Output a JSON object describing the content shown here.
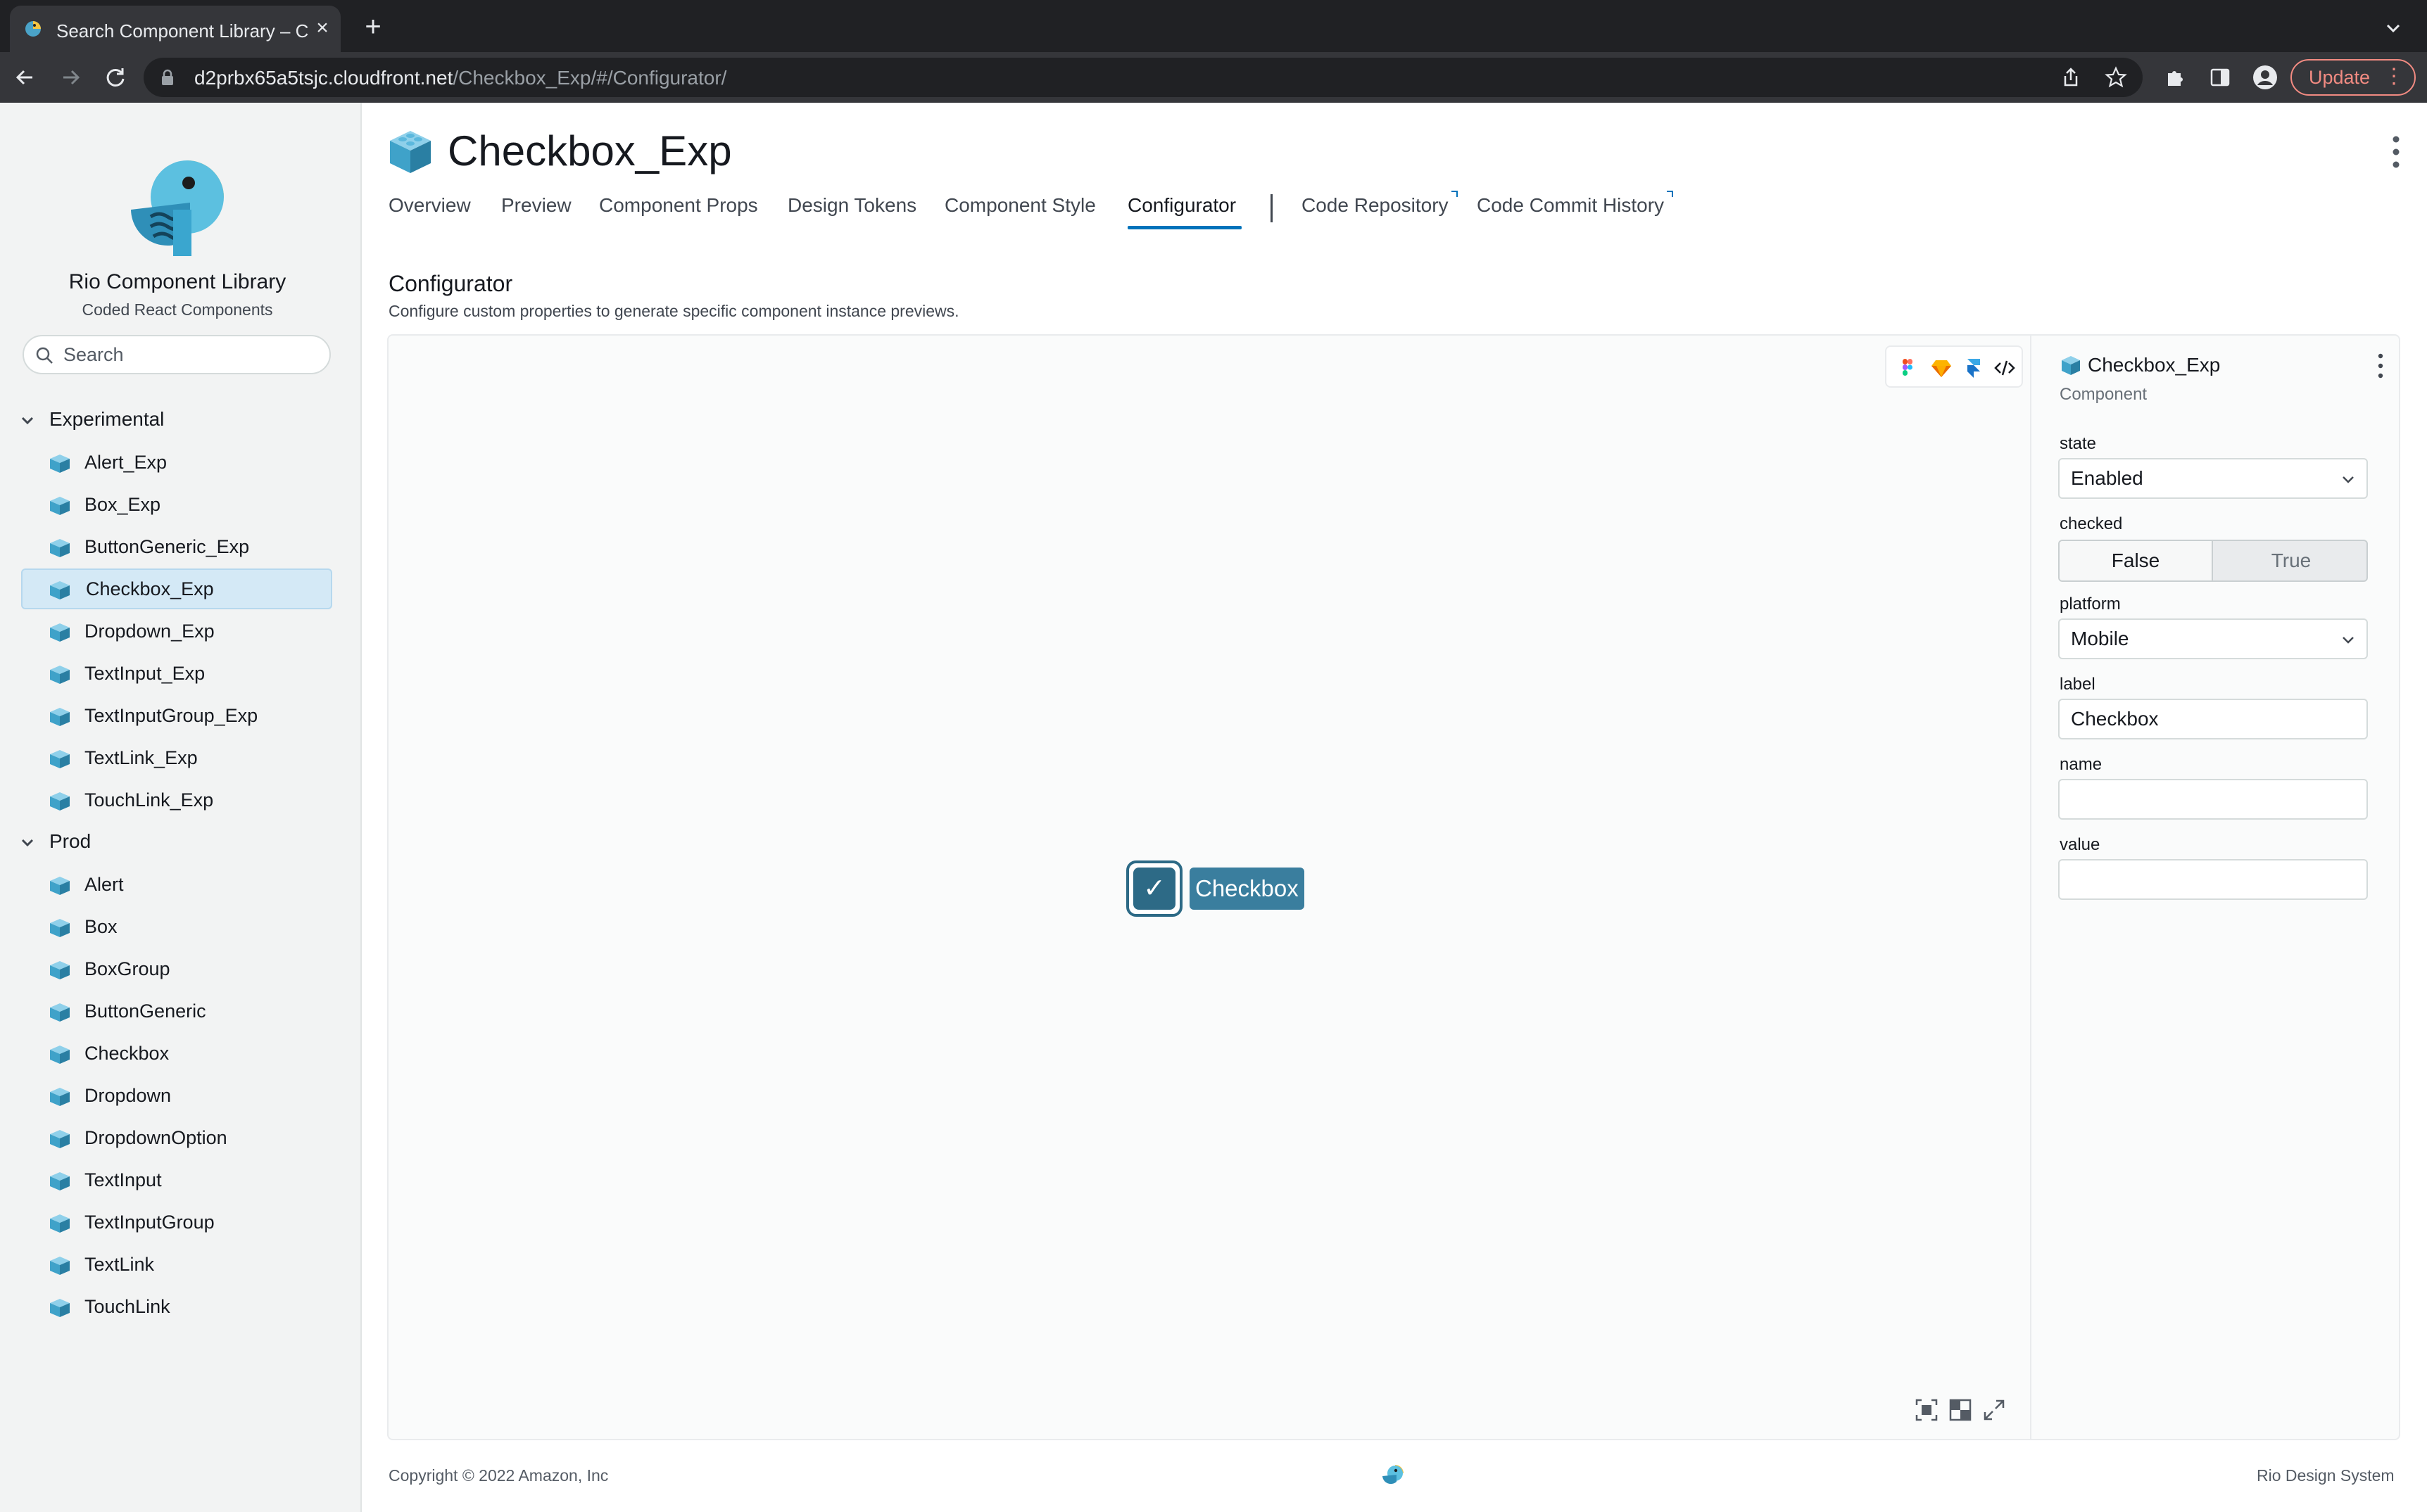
{
  "browser": {
    "tab_title": "Search Component Library – C",
    "url_host": "d2prbx65a5tsjc.cloudfront.net",
    "url_path": "/Checkbox_Exp/#/Configurator/",
    "update_label": "Update"
  },
  "sidebar": {
    "title": "Rio Component Library",
    "subtitle": "Coded React Components",
    "search_placeholder": "Search",
    "groups": [
      {
        "label": "Experimental",
        "items": [
          "Alert_Exp",
          "Box_Exp",
          "ButtonGeneric_Exp",
          "Checkbox_Exp",
          "Dropdown_Exp",
          "TextInput_Exp",
          "TextInputGroup_Exp",
          "TextLink_Exp",
          "TouchLink_Exp"
        ]
      },
      {
        "label": "Prod",
        "items": [
          "Alert",
          "Box",
          "BoxGroup",
          "ButtonGeneric",
          "Checkbox",
          "Dropdown",
          "DropdownOption",
          "TextInput",
          "TextInputGroup",
          "TextLink",
          "TouchLink"
        ]
      }
    ],
    "active_item": "Checkbox_Exp"
  },
  "header": {
    "title": "Checkbox_Exp",
    "tabs": [
      "Overview",
      "Preview",
      "Component Props",
      "Design Tokens",
      "Component Style",
      "Configurator",
      "Code Repository",
      "Code Commit History"
    ],
    "active_tab": "Configurator"
  },
  "section": {
    "title": "Configurator",
    "description": "Configure custom properties to generate specific component instance previews."
  },
  "preview": {
    "checkbox_label": "Checkbox",
    "checkbox_checked": true
  },
  "props": {
    "title": "Checkbox_Exp",
    "subtitle": "Component",
    "state_label": "state",
    "state_value": "Enabled",
    "checked_label": "checked",
    "checked_options": [
      "False",
      "True"
    ],
    "checked_selected": "False",
    "platform_label": "platform",
    "platform_value": "Mobile",
    "label_label": "label",
    "label_value": "Checkbox",
    "name_label": "name",
    "name_value": "",
    "value_label": "value",
    "value_value": ""
  },
  "footer": {
    "copyright": "Copyright © 2022 Amazon, Inc",
    "right": "Rio Design System"
  },
  "colors": {
    "accent": "#0073bb",
    "active_nav_bg": "#d4e9f6",
    "checkbox_teal": "#2d6a86",
    "update_red": "#f28b82"
  }
}
